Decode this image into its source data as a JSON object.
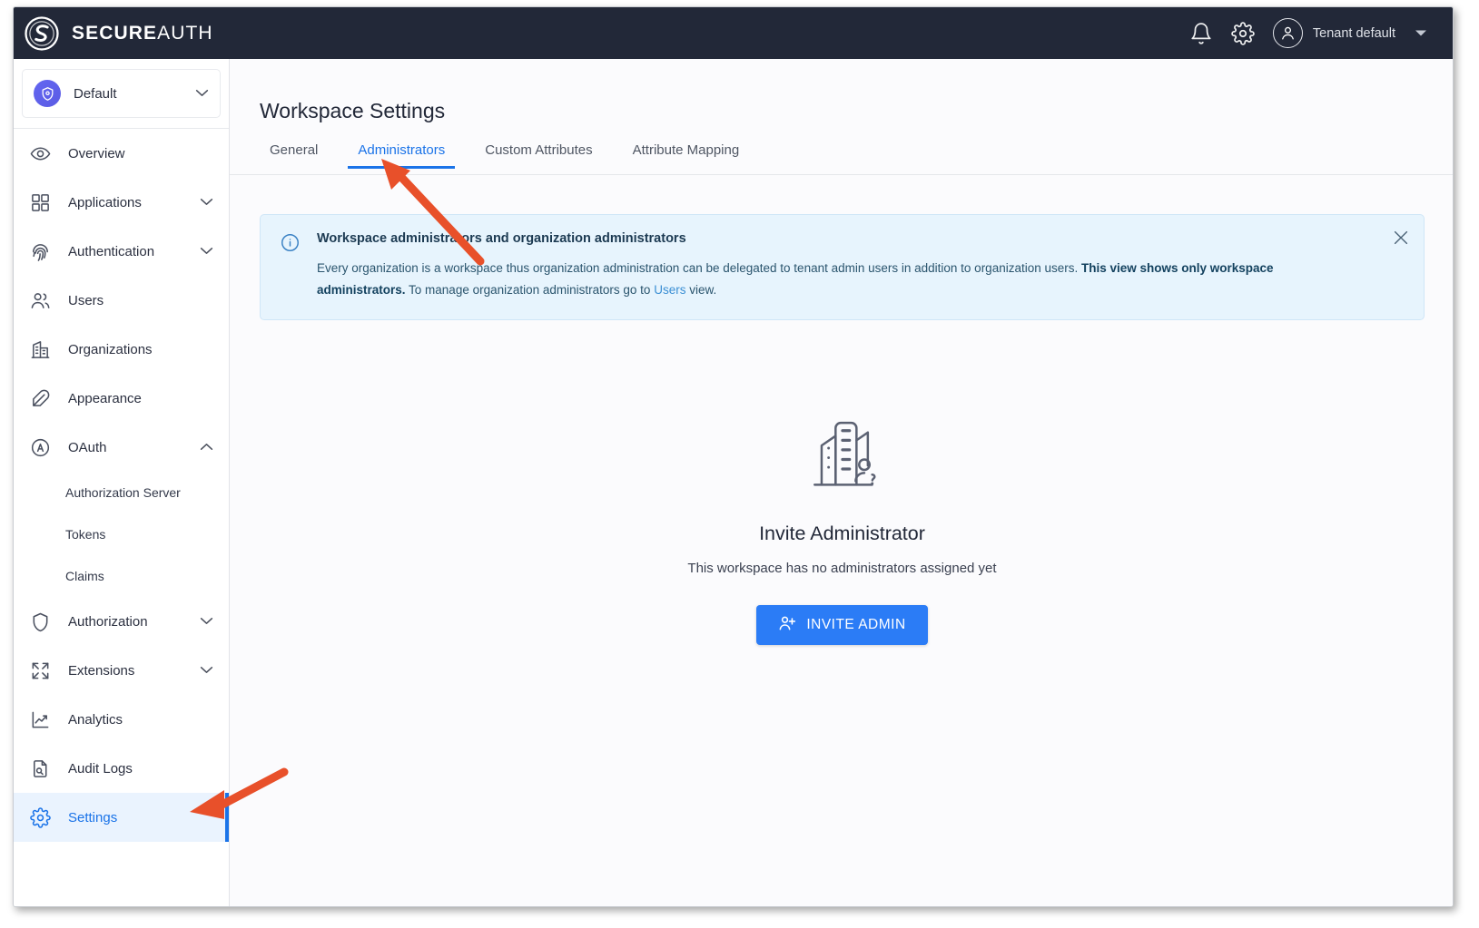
{
  "header": {
    "brand_bold": "SECURE",
    "brand_light": "AUTH",
    "logo_icon": "secureauth-logo-icon",
    "notification_icon": "bell-icon",
    "settings_icon": "gear-icon",
    "avatar_icon": "user-avatar-icon",
    "tenant_label": "Tenant default",
    "tenant_caret_icon": "caret-down-icon",
    "bg_color": "#222838"
  },
  "sidebar": {
    "tenant_selector": {
      "label": "Default",
      "badge_icon": "shield-check-icon",
      "chevron_icon": "chevron-down-icon"
    },
    "items": [
      {
        "label": "Overview",
        "icon": "eye-icon",
        "expandable": false,
        "active": false,
        "sub": false
      },
      {
        "label": "Applications",
        "icon": "grid-icon",
        "expandable": true,
        "active": false,
        "sub": false
      },
      {
        "label": "Authentication",
        "icon": "fingerprint-icon",
        "expandable": true,
        "active": false,
        "sub": false
      },
      {
        "label": "Users",
        "icon": "users-icon",
        "expandable": false,
        "active": false,
        "sub": false
      },
      {
        "label": "Organizations",
        "icon": "building-icon",
        "expandable": false,
        "active": false,
        "sub": false
      },
      {
        "label": "Appearance",
        "icon": "feather-icon",
        "expandable": false,
        "active": false,
        "sub": false
      },
      {
        "label": "OAuth",
        "icon": "oauth-circle-icon",
        "expandable": true,
        "active": false,
        "sub": false,
        "expanded": true
      },
      {
        "label": "Authorization Server",
        "icon": "",
        "expandable": false,
        "active": false,
        "sub": true
      },
      {
        "label": "Tokens",
        "icon": "",
        "expandable": false,
        "active": false,
        "sub": true
      },
      {
        "label": "Claims",
        "icon": "",
        "expandable": false,
        "active": false,
        "sub": true
      },
      {
        "label": "Authorization",
        "icon": "shield-icon",
        "expandable": true,
        "active": false,
        "sub": false
      },
      {
        "label": "Extensions",
        "icon": "expand-icon",
        "expandable": true,
        "active": false,
        "sub": false
      },
      {
        "label": "Analytics",
        "icon": "chart-line-icon",
        "expandable": false,
        "active": false,
        "sub": false
      },
      {
        "label": "Audit Logs",
        "icon": "document-search-icon",
        "expandable": false,
        "active": false,
        "sub": false
      },
      {
        "label": "Settings",
        "icon": "gear-icon",
        "expandable": false,
        "active": true,
        "sub": false
      }
    ],
    "accent_color": "#1a73e8",
    "active_bg": "#eaf3fe"
  },
  "main": {
    "page_title": "Workspace Settings",
    "tabs": [
      {
        "label": "General",
        "selected": false
      },
      {
        "label": "Administrators",
        "selected": true
      },
      {
        "label": "Custom Attributes",
        "selected": false
      },
      {
        "label": "Attribute Mapping",
        "selected": false
      }
    ],
    "banner": {
      "info_icon": "info-circle-icon",
      "close_icon": "close-icon",
      "title": "Workspace administrators and organization administrators",
      "text_part1": "Every organization is a workspace thus organization administration can be delegated to tenant admin users in addition to organization users. ",
      "text_bold": "This view shows only workspace administrators.",
      "text_part2": " To manage organization administrators go to ",
      "link_text": "Users",
      "text_part3": " view.",
      "bg_color": "#e7f4fd",
      "border_color": "#cfe6f7"
    },
    "empty_state": {
      "illustration_icon": "building-person-question-icon",
      "title": "Invite Administrator",
      "subtitle": "This workspace has no administrators assigned yet",
      "button_label": "INVITE ADMIN",
      "button_icon": "user-plus-icon",
      "button_color": "#2b7cf6"
    }
  },
  "annotations": {
    "arrow_color": "#e8502a",
    "arrow_tab_target": "Administrators",
    "arrow_sidebar_target": "Settings"
  }
}
